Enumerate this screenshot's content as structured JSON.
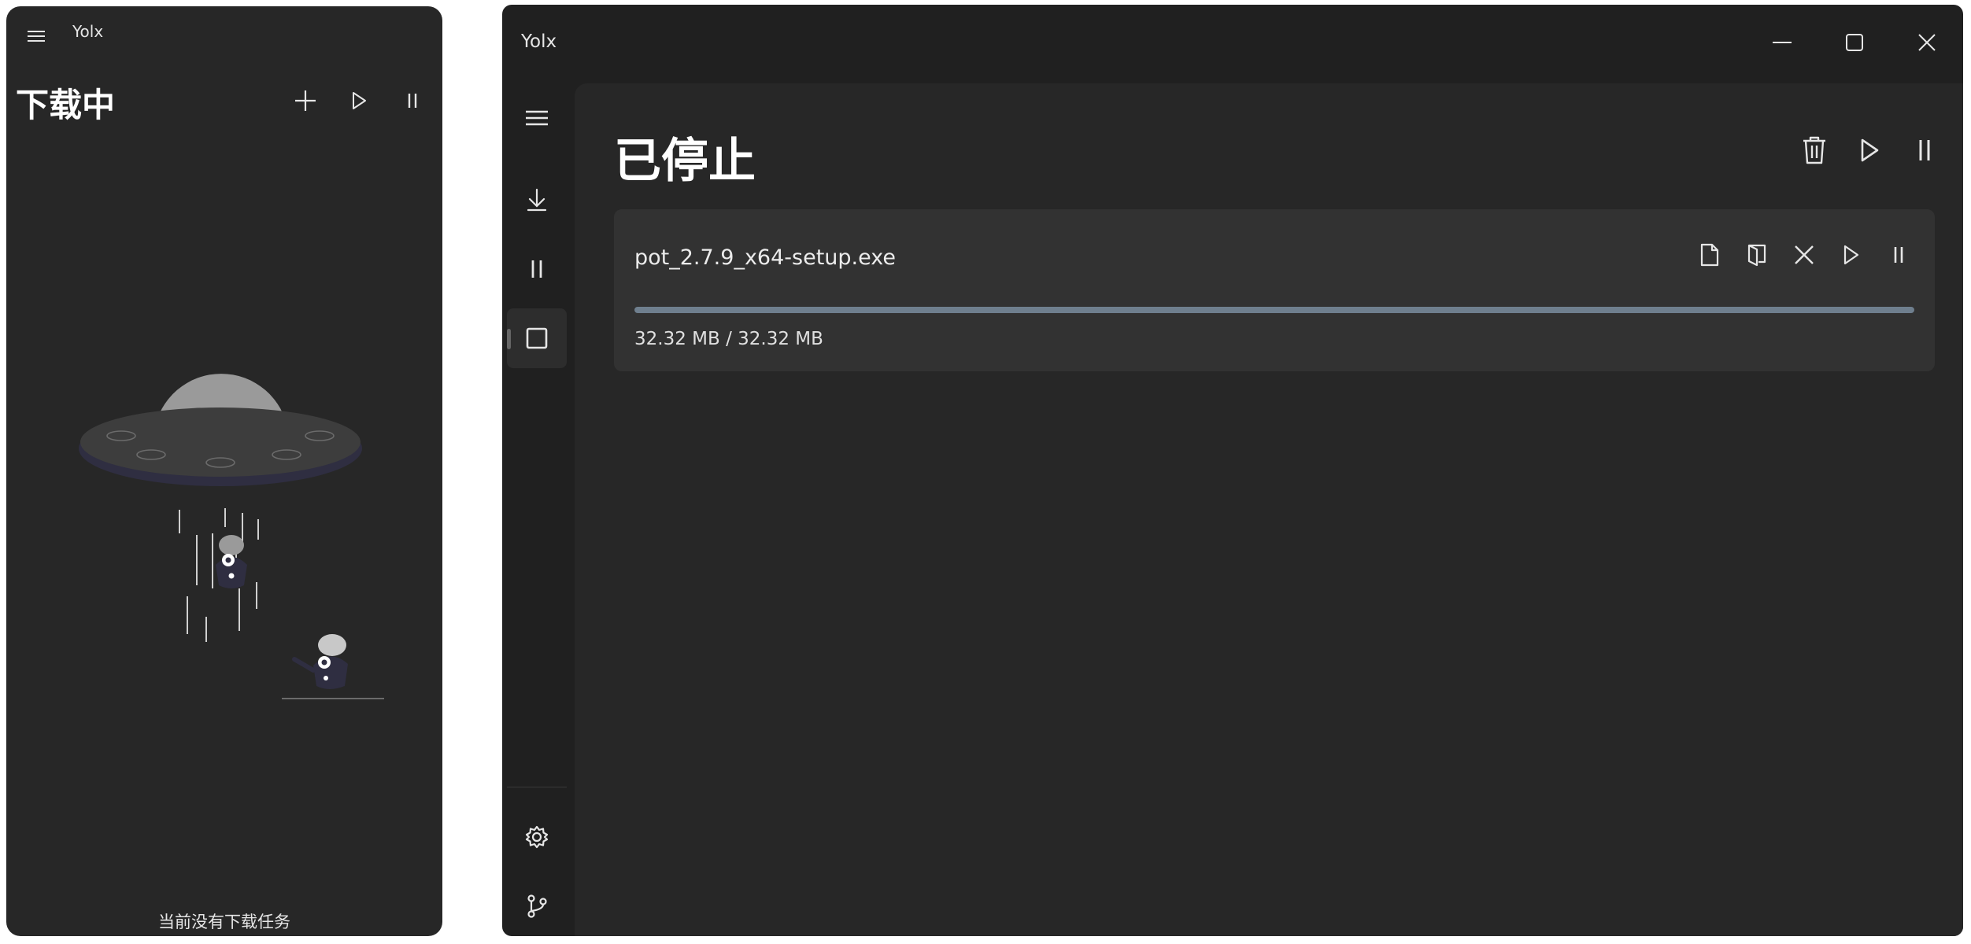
{
  "left_window": {
    "title": "Yolx",
    "heading": "下载中",
    "empty_message": "当前没有下载任务",
    "icons": [
      "menu-icon",
      "plus-icon",
      "play-icon",
      "pause-icon"
    ]
  },
  "right_window": {
    "title": "Yolx",
    "heading": "已停止",
    "caption_icons": [
      "minimize-icon",
      "maximize-icon",
      "close-icon"
    ],
    "nav_icons": [
      "menu-icon",
      "download-icon",
      "pause-icon",
      "stop-icon",
      "settings-icon",
      "git-branch-icon"
    ],
    "active_nav": "stop",
    "header_icons": [
      "trash-icon",
      "play-icon",
      "pause-icon"
    ],
    "task": {
      "file_name": "pot_2.7.9_x64-setup.exe",
      "size_text": "32.32 MB / 32.32 MB",
      "progress_percent": 100,
      "action_icons": [
        "file-icon",
        "open-folder-icon",
        "delete-x-icon",
        "play-icon",
        "pause-icon"
      ]
    }
  },
  "colors": {
    "window_bg": "#272727",
    "titlebar_bg": "#202020",
    "card_bg": "#323232",
    "progress_fill": "#6f7f8e",
    "illustration_accent": "#2f2e41",
    "illustration_gray": "#9a9a9a"
  }
}
